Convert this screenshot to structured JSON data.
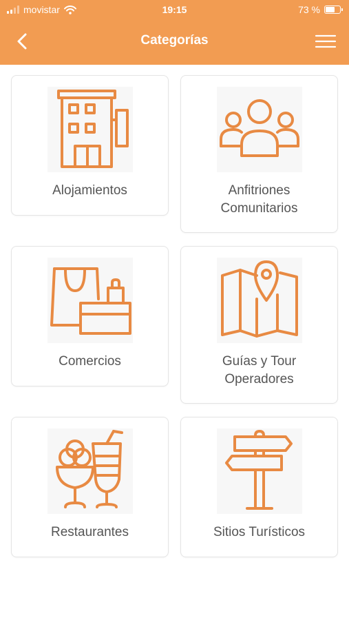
{
  "status_bar": {
    "carrier": "movistar",
    "time": "19:15",
    "battery_percent": "73 %",
    "battery_level": 0.73
  },
  "header": {
    "title": "Categorías",
    "back_icon": "chevron-left-icon",
    "menu_icon": "hamburger-menu-icon"
  },
  "colors": {
    "accent": "#f29c52",
    "icon": "#e88a43",
    "text": "#555555"
  },
  "categories": [
    {
      "label": "Alojamientos",
      "icon": "hotel-building-icon"
    },
    {
      "label": "Anfitriones\nComunitarios",
      "icon": "people-group-icon"
    },
    {
      "label": "Comercios",
      "icon": "shopping-bags-icon"
    },
    {
      "label": "Guías y Tour\nOperadores",
      "icon": "map-pin-icon"
    },
    {
      "label": "Restaurantes",
      "icon": "ice-cream-drink-icon"
    },
    {
      "label": "Sitios Turísticos",
      "icon": "signpost-icon"
    }
  ]
}
